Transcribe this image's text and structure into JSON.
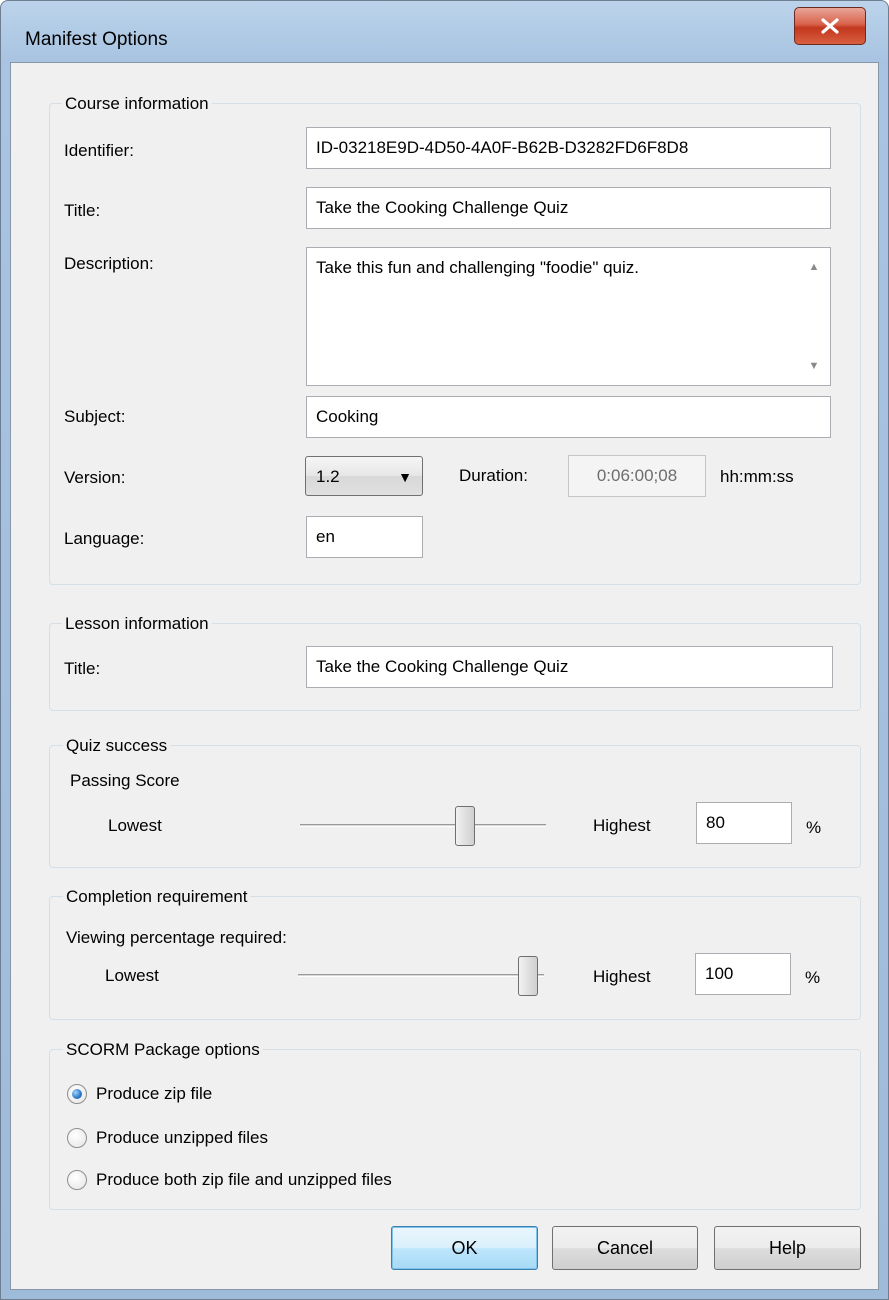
{
  "window": {
    "title": "Manifest Options"
  },
  "course": {
    "legend": "Course information",
    "identifier_label": "Identifier:",
    "identifier_value": "ID-03218E9D-4D50-4A0F-B62B-D3282FD6F8D8",
    "title_label": "Title:",
    "title_value": "Take the Cooking Challenge Quiz",
    "description_label": "Description:",
    "description_value": "Take this fun and challenging \"foodie\" quiz.",
    "subject_label": "Subject:",
    "subject_value": "Cooking",
    "version_label": "Version:",
    "version_value": "1.2",
    "duration_label": "Duration:",
    "duration_value": "0:06:00;08",
    "duration_unit": "hh:mm:ss",
    "language_label": "Language:",
    "language_value": "en"
  },
  "lesson": {
    "legend": "Lesson information",
    "title_label": "Title:",
    "title_value": "Take the Cooking Challenge Quiz"
  },
  "quiz": {
    "legend": "Quiz success",
    "passing_label": "Passing Score",
    "lowest_label": "Lowest",
    "highest_label": "Highest",
    "value": "80",
    "percent": "%",
    "slider_fraction": 0.8
  },
  "completion": {
    "legend": "Completion requirement",
    "viewing_label": "Viewing percentage required:",
    "lowest_label": "Lowest",
    "highest_label": "Highest",
    "value": "100",
    "percent": "%",
    "slider_fraction": 1.0
  },
  "scorm": {
    "legend": "SCORM Package options",
    "options": [
      {
        "label": "Produce zip file",
        "selected": true
      },
      {
        "label": "Produce unzipped files",
        "selected": false
      },
      {
        "label": "Produce both zip file and unzipped files",
        "selected": false
      }
    ]
  },
  "buttons": {
    "ok": "OK",
    "cancel": "Cancel",
    "help": "Help"
  },
  "icons": {
    "close": "close-icon",
    "dropdown": "chevron-down-icon",
    "scroll_up": "scroll-up-arrow-icon",
    "scroll_down": "scroll-down-arrow-icon"
  },
  "colors": {
    "close_button": "#c94a32",
    "default_button": "#bee6fd",
    "window_frame": "#a8c4e2"
  }
}
